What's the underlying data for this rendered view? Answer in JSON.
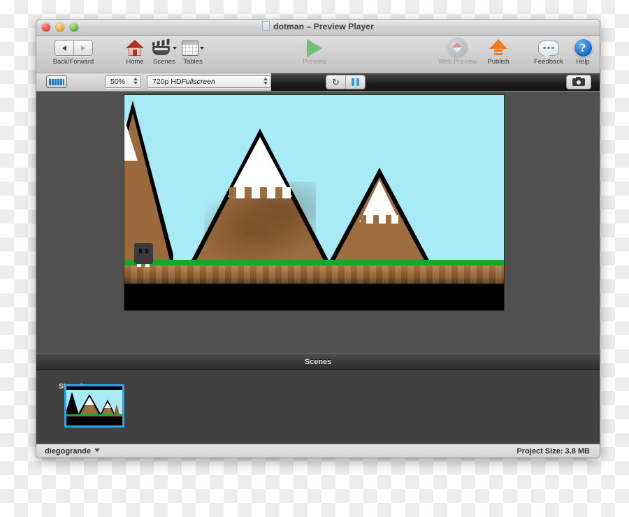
{
  "window": {
    "title": "dotman – Preview Player",
    "traffic_lights": [
      "close",
      "minimize",
      "zoom"
    ],
    "doc_icon": "document-icon"
  },
  "toolbar": {
    "items": [
      {
        "id": "back-forward",
        "label": "Back/Forward",
        "icon": "back-forward-arrows-icon",
        "enabled": true
      },
      {
        "id": "home",
        "label": "Home",
        "icon": "house-icon",
        "enabled": true
      },
      {
        "id": "scenes",
        "label": "Scenes",
        "icon": "clapperboard-icon",
        "enabled": true,
        "has_menu": true
      },
      {
        "id": "tables",
        "label": "Tables",
        "icon": "table-grid-icon",
        "enabled": true,
        "has_menu": true
      },
      {
        "id": "preview",
        "label": "Preview",
        "icon": "play-triangle-icon",
        "enabled": false
      },
      {
        "id": "web-preview",
        "label": "Web Preview",
        "icon": "compass-icon",
        "enabled": false
      },
      {
        "id": "publish",
        "label": "Publish",
        "icon": "up-arrow-icon",
        "enabled": true
      },
      {
        "id": "feedback",
        "label": "Feedback",
        "icon": "speech-bubble-icon",
        "enabled": true
      },
      {
        "id": "help",
        "label": "Help",
        "icon": "question-mark-icon",
        "enabled": true
      }
    ]
  },
  "controlbar": {
    "filmstrip_icon": "filmstrip-icon",
    "zoom_value": "50%",
    "resolution_value": "720p HD Fullscreen",
    "resolution_prefix": "720p HD ",
    "resolution_suffix": "Fullscreen",
    "restart_icon": "restart-icon",
    "restart_glyph": "↻",
    "pause_icon": "pause-icon",
    "snapshot_icon": "camera-icon"
  },
  "stage": {
    "name": "preview-canvas",
    "background_color": "#505050",
    "sky_color": "#a9eaf7",
    "grass_color": "#17a82a",
    "dirt_color": "#a7713f",
    "ground_color": "#000000",
    "mountain_color": "#9d6d3f",
    "snow_color": "#ffffff",
    "character": {
      "name": "player-sprite",
      "color": "#3a3a3a"
    }
  },
  "scenes": {
    "header": "Scenes",
    "items": [
      {
        "label": "Stage 1 copy",
        "selected": true
      }
    ]
  },
  "status": {
    "account": "diegogrande",
    "project_size": "Project Size: 3.8 MB"
  },
  "colors": {
    "accent_blue": "#2aa8e6",
    "pause_blue": "#2f9ce0",
    "publish_orange": "#f07a20",
    "play_green": "#6fbf7d",
    "help_blue": "#0a63c4"
  }
}
